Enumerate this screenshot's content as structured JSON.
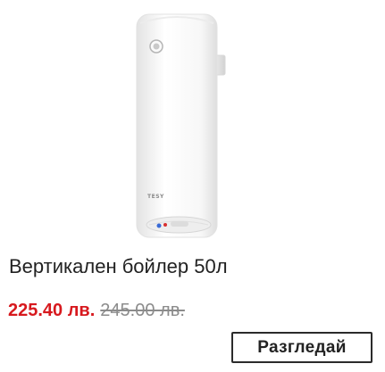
{
  "product": {
    "image_alt": "Вертикален бойлер 50л",
    "brand_logo_text": "TESY",
    "title": "Вертикален бойлер 50л",
    "price_current": "225.40 лв.",
    "price_old": "245.00 лв."
  },
  "actions": {
    "view_label": "Разгледай"
  },
  "colors": {
    "sale_price": "#d7191e",
    "old_price": "#8c8c8c",
    "button_border": "#2b2b2b"
  }
}
